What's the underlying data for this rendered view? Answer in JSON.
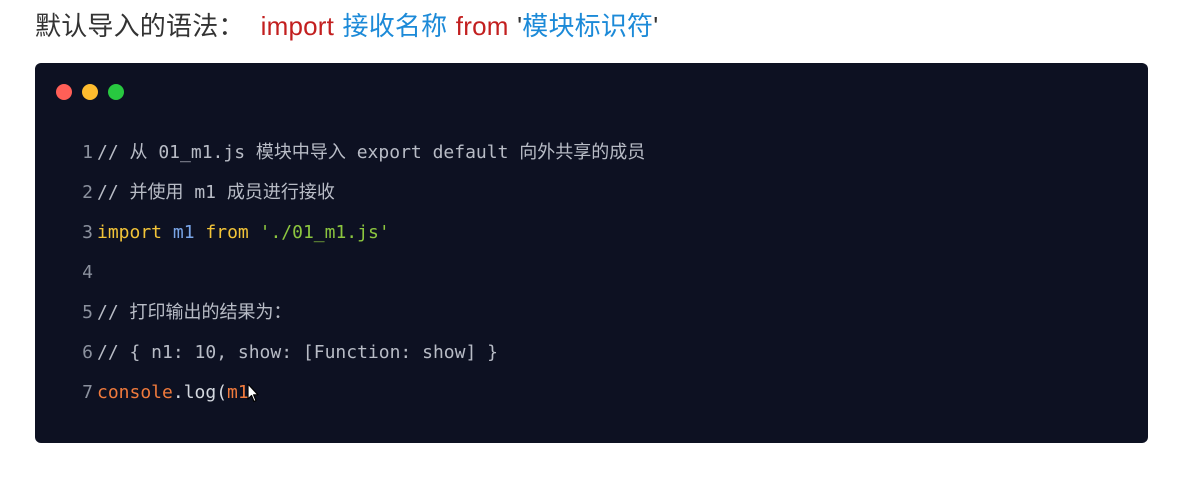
{
  "heading": {
    "label": "默认导入的语法：",
    "kw_import": "import",
    "receiver_name": "接收名称",
    "kw_from": "from",
    "quote_open": "'",
    "module_id": "模块标识符",
    "quote_close": "'"
  },
  "window_dots": {
    "colors": [
      "#ff5f57",
      "#febc2e",
      "#28c840"
    ]
  },
  "code": {
    "lines": [
      {
        "num": "1",
        "comment": "// 从 01_m1.js 模块中导入 export default 向外共享的成员"
      },
      {
        "num": "2",
        "comment": "// 并使用 m1 成员进行接收"
      },
      {
        "num": "3",
        "kw_import": "import",
        "ident": "m1",
        "kw_from": "from",
        "string": "'./01_m1.js'"
      },
      {
        "num": "4"
      },
      {
        "num": "5",
        "comment": "// 打印输出的结果为："
      },
      {
        "num": "6",
        "comment": "// { n1: 10, show: [Function: show] }"
      },
      {
        "num": "7",
        "object": "console",
        "method": ".log(",
        "arg": "m1"
      }
    ]
  },
  "colors": {
    "keyword": "#f2c438",
    "identifier": "#7aa6e8",
    "string": "#8cc63f",
    "object": "#f07a3c",
    "heading_red": "#c21f1f",
    "heading_blue": "#1c8ad8",
    "code_background": "#0d1122"
  }
}
